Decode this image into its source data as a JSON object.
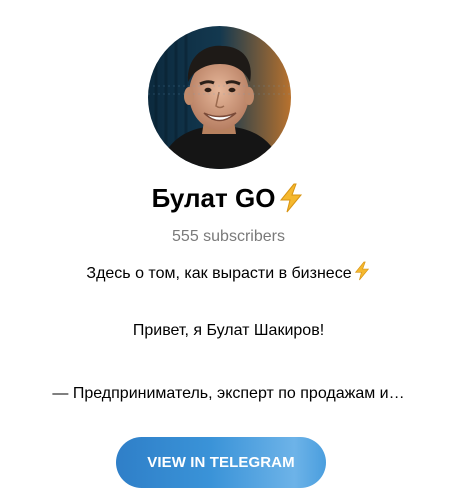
{
  "channel": {
    "title": "Булат GO",
    "title_icon": "lightning-bolt-icon",
    "subscribers": "555 subscribers"
  },
  "description": {
    "line1": "Здесь о том, как вырасти в бизнесе",
    "line1_icon": "lightning-bolt-icon",
    "line2": "Привет, я Булат Шакиров!",
    "line3": "— Предприниматель, эксперт по продажам и…"
  },
  "button": {
    "label": "VIEW IN TELEGRAM"
  },
  "colors": {
    "accent": "#3a93d8",
    "subtitle": "#7a7a7a",
    "bolt": "#f5b82e"
  }
}
